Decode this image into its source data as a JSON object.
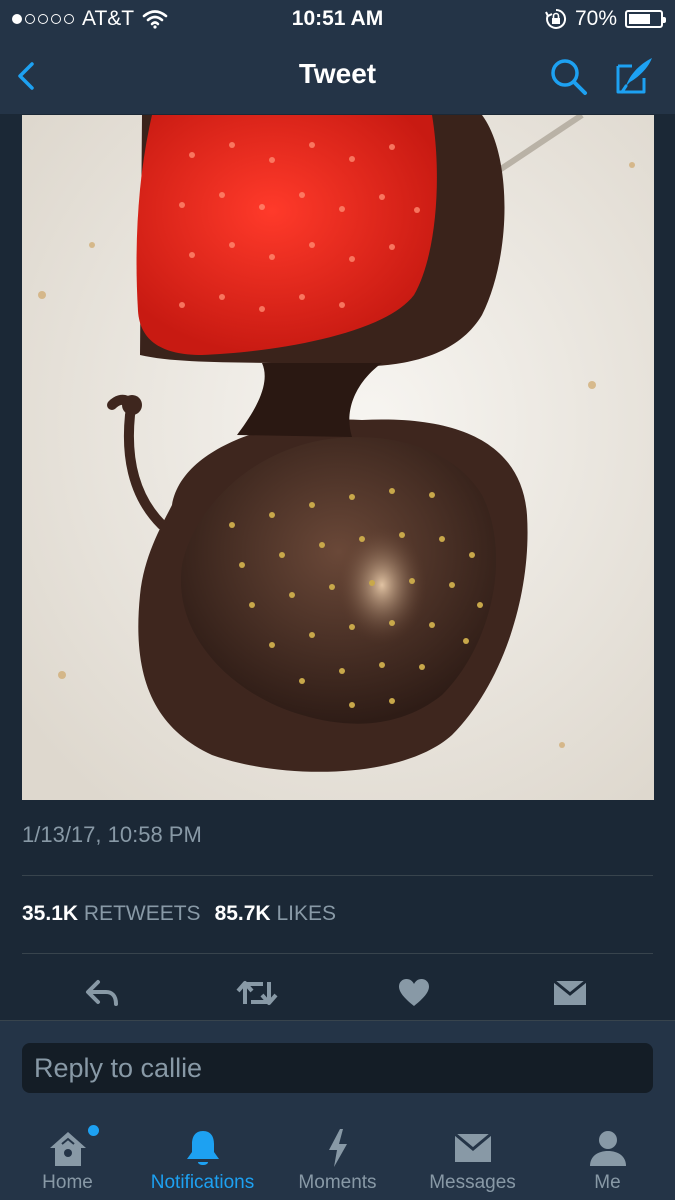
{
  "status_bar": {
    "carrier": "AT&T",
    "time": "10:51 AM",
    "battery": "70%",
    "battery_level": 0.7
  },
  "nav": {
    "title": "Tweet"
  },
  "tweet": {
    "timestamp": "1/13/17, 10:58 PM",
    "retweets_count": "35.1K",
    "retweets_label": "RETWEETS",
    "likes_count": "85.7K",
    "likes_label": "LIKES"
  },
  "reply": {
    "placeholder": "Reply to callie"
  },
  "tabs": [
    {
      "label": "Home",
      "icon": "home-icon"
    },
    {
      "label": "Notifications",
      "icon": "bell-icon"
    },
    {
      "label": "Moments",
      "icon": "lightning-icon"
    },
    {
      "label": "Messages",
      "icon": "envelope-icon"
    },
    {
      "label": "Me",
      "icon": "person-icon"
    }
  ],
  "colors": {
    "background": "#1b2836",
    "bar": "#243447",
    "accent": "#1da1f2",
    "muted": "#8899a6"
  }
}
